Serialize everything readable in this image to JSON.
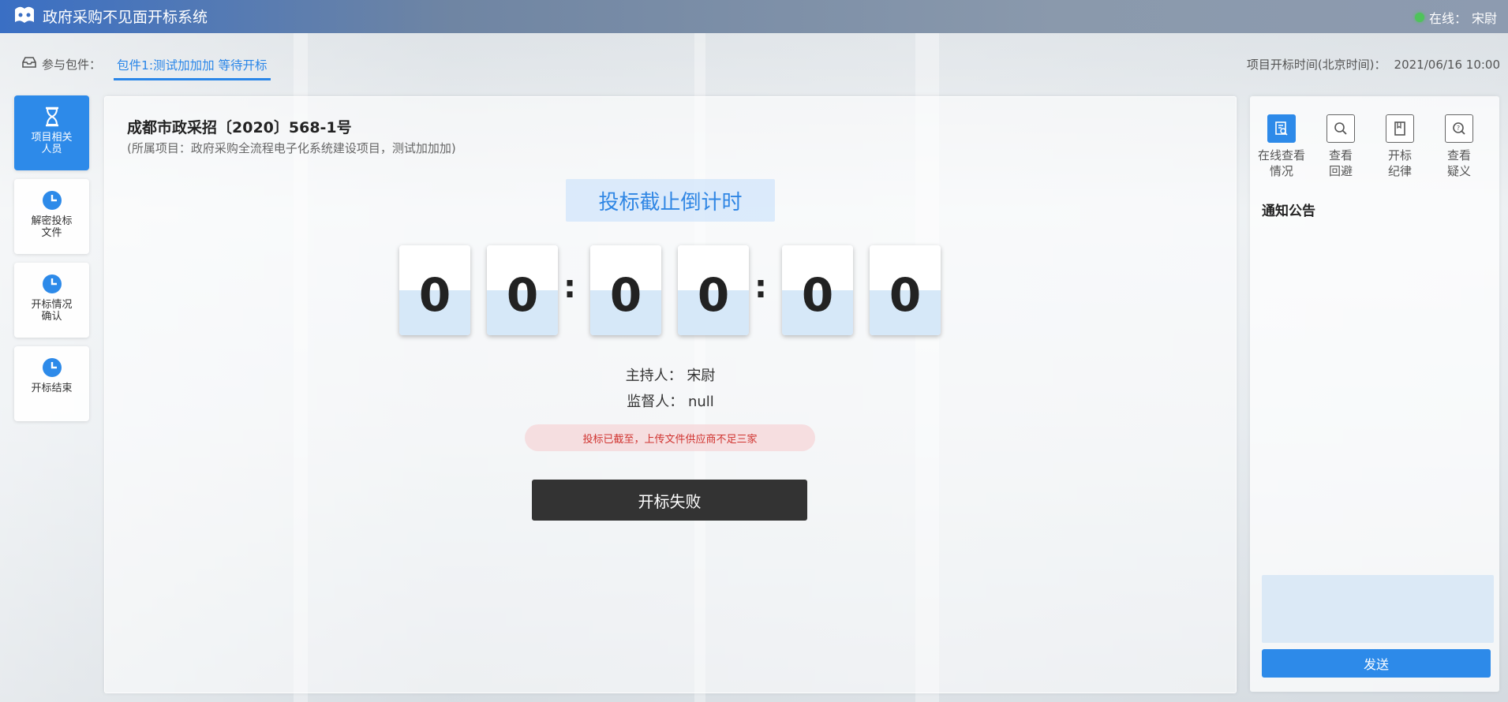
{
  "header": {
    "app_title": "政府采购不见面开标系统",
    "online_label": "在线：",
    "user_name": "宋尉"
  },
  "package_bar": {
    "label": "参与包件：",
    "active_tab": "包件1:测试加加加 等待开标",
    "open_time_label": "项目开标时间(北京时间)：",
    "open_time_value": "2021/06/16 10:00"
  },
  "sidebar": {
    "items": [
      {
        "label": "项目相关人员",
        "icon": "hourglass-icon",
        "active": true
      },
      {
        "label": "解密投标文件",
        "icon": "clock-icon",
        "active": false
      },
      {
        "label": "开标情况确认",
        "icon": "clock-icon",
        "active": false
      },
      {
        "label": "开标结束",
        "icon": "clock-icon",
        "active": false
      }
    ]
  },
  "main": {
    "project_number": "成都市政采招〔2020〕568-1号",
    "project_subtitle": "(所属项目：政府采购全流程电子化系统建设项目，测试加加加)",
    "countdown_title": "投标截止倒计时",
    "digits": [
      "0",
      "0",
      "0",
      "0",
      "0",
      "0"
    ],
    "separator": ":",
    "host_label": "主持人：",
    "host_name": "宋尉",
    "supervisor_label": "监督人：",
    "supervisor_name": "null",
    "warning": "投标已截至，上传文件供应商不足三家",
    "fail_button": "开标失败"
  },
  "right_panel": {
    "tools": [
      {
        "label": "在线查看情况",
        "icon": "document-search-icon",
        "active": true
      },
      {
        "label": "查看回避",
        "icon": "magnifier-icon",
        "active": false
      },
      {
        "label": "开标纪律",
        "icon": "book-icon",
        "active": false
      },
      {
        "label": "查看疑义",
        "icon": "question-icon",
        "active": false
      }
    ],
    "notice_title": "通知公告",
    "send_button": "发送"
  },
  "colors": {
    "accent": "#2d8ae9",
    "danger": "#d0332f",
    "online": "#4fc35b"
  }
}
